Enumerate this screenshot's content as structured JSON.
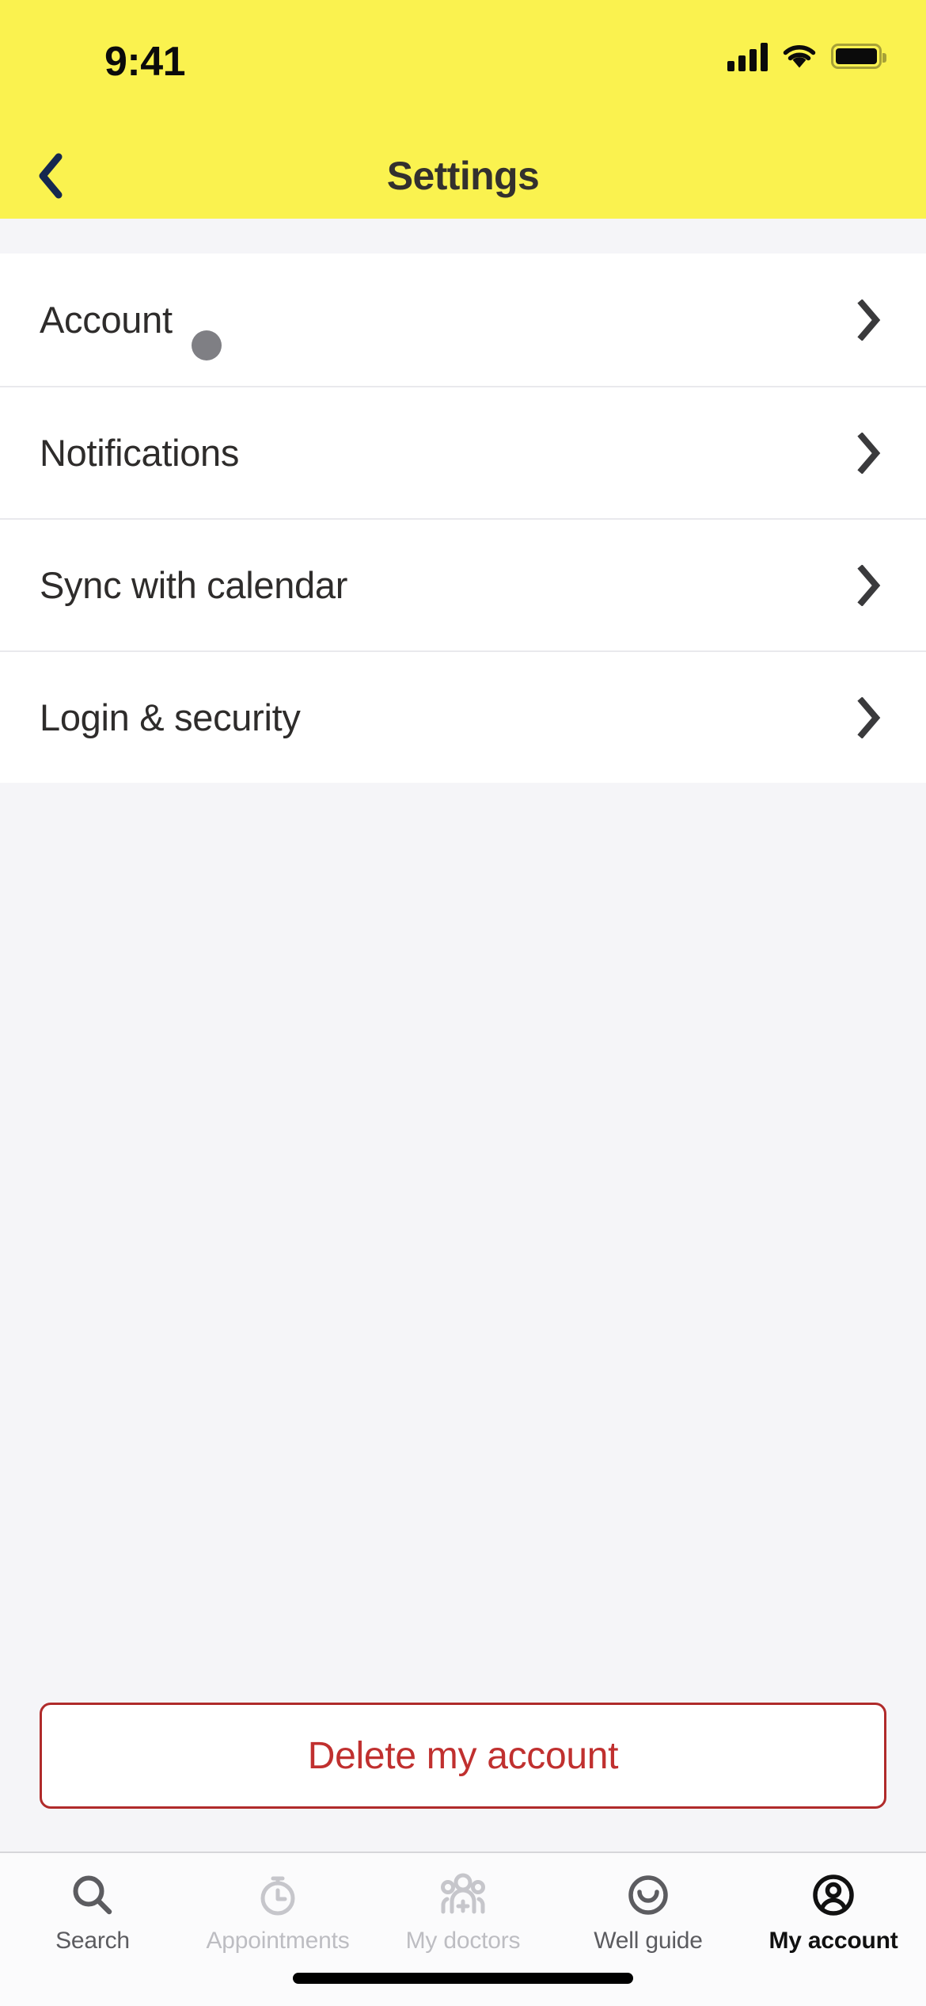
{
  "theme": {
    "header_bg": "#FAF24F",
    "page_bg": "#F5F5F8",
    "card_bg": "#FFFFFF",
    "title_color": "#33302E",
    "back_arrow_color": "#16284F",
    "danger_color": "#C0302F",
    "danger_border": "#B02B2B",
    "badge_dot_color": "#7F7F84",
    "chevron_color": "#3A3A3C",
    "tab_active_color": "#111111",
    "tab_inactive_color": "#BDBDC2",
    "tab_mid_color": "#5C5C60"
  },
  "status_bar": {
    "time": "9:41",
    "cellular_icon": "cellular-signal-icon",
    "wifi_icon": "wifi-icon",
    "battery_icon": "battery-full-icon"
  },
  "nav": {
    "back_icon": "chevron-left-icon",
    "title": "Settings"
  },
  "settings_list": {
    "rows": [
      {
        "label": "Account",
        "has_badge": true,
        "chevron": "chevron-right-icon"
      },
      {
        "label": "Notifications",
        "has_badge": false,
        "chevron": "chevron-right-icon"
      },
      {
        "label": "Sync with calendar",
        "has_badge": false,
        "chevron": "chevron-right-icon"
      },
      {
        "label": "Login & security",
        "has_badge": false,
        "chevron": "chevron-right-icon"
      }
    ]
  },
  "actions": {
    "delete_account_label": "Delete my account"
  },
  "tab_bar": {
    "items": [
      {
        "label": "Search",
        "icon": "magnifying-glass-icon",
        "state": "mid"
      },
      {
        "label": "Appointments",
        "icon": "stopwatch-icon",
        "state": "dim"
      },
      {
        "label": "My doctors",
        "icon": "people-medical-icon",
        "state": "dim"
      },
      {
        "label": "Well guide",
        "icon": "smiley-face-icon",
        "state": "mid"
      },
      {
        "label": "My account",
        "icon": "user-circle-icon",
        "state": "active"
      }
    ]
  },
  "home_indicator": "home-indicator-bar"
}
